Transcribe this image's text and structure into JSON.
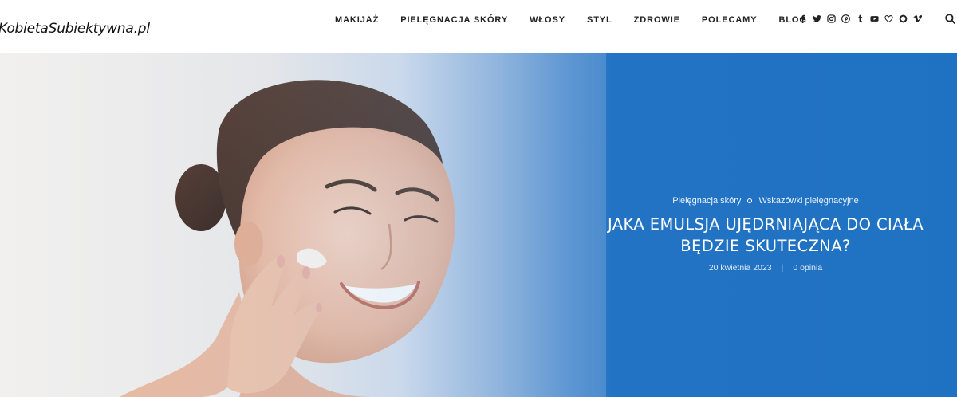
{
  "site": {
    "logo_text": "KobietaSubiektywna.pl"
  },
  "nav": {
    "items": [
      {
        "label": "MAKIJAŻ"
      },
      {
        "label": "PIELĘGNACJA SKÓRY"
      },
      {
        "label": "WŁOSY"
      },
      {
        "label": "STYL"
      },
      {
        "label": "ZDROWIE"
      },
      {
        "label": "POLECAMY"
      },
      {
        "label": "BLOG"
      }
    ]
  },
  "social_icons": [
    "facebook-icon",
    "twitter-icon",
    "instagram-icon",
    "pinterest-icon",
    "tumblr-icon",
    "youtube-icon",
    "heart-icon",
    "circle-icon",
    "vimeo-icon"
  ],
  "search_icon": "search-icon",
  "hero": {
    "categories": [
      "Pielęgnacja skóry",
      "Wskazówki pielęgnacyjne"
    ],
    "title": "JAKA EMULSJA UJĘDRNIAJĄCA DO CIAŁA BĘDZIE SKUTECZNA?",
    "date": "20 kwietnia 2023",
    "comments": "0 opinia"
  },
  "colors": {
    "hero_blue": "#1f72c2",
    "text_dark": "#222222"
  }
}
